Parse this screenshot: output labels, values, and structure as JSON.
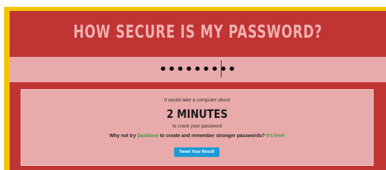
{
  "header": {
    "title": "HOW SECURE IS MY PASSWORD?"
  },
  "password": {
    "value": "•••••••••"
  },
  "result": {
    "intro": "It would take a computer about",
    "time": "2 MINUTES",
    "suffix": "to crack your password",
    "suggestion": {
      "before": "Why not try",
      "brand": "Dashlane",
      "middle": "to create and remember stronger passwords?",
      "free": "It's free!"
    },
    "tweet_label": "Tweet Your Result"
  },
  "colors": {
    "frame": "#f5c400",
    "card": "#c03434",
    "band": "#e8aaaa",
    "link": "#3b9a3b",
    "button": "#1e9bd6"
  }
}
